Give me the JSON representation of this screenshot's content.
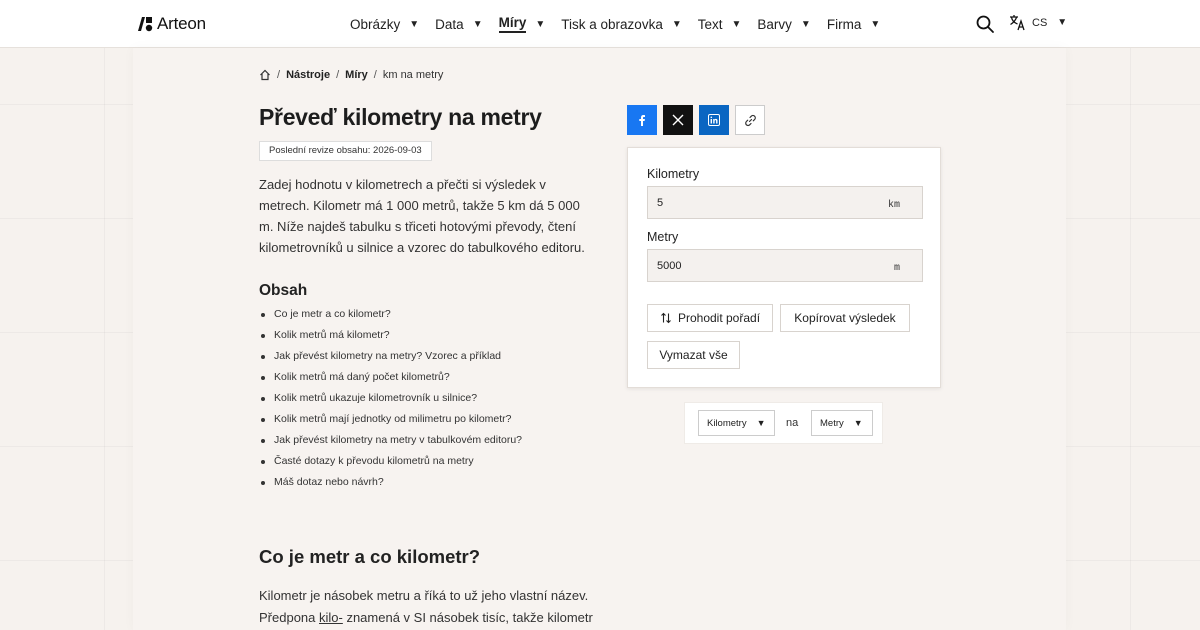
{
  "header": {
    "logo_text": "Arteon",
    "nav": [
      {
        "label": "Obrázky",
        "active": false
      },
      {
        "label": "Data",
        "active": false
      },
      {
        "label": "Míry",
        "active": true
      },
      {
        "label": "Tisk a obrazovka",
        "active": false
      },
      {
        "label": "Text",
        "active": false
      },
      {
        "label": "Barvy",
        "active": false
      },
      {
        "label": "Firma",
        "active": false
      }
    ],
    "lang": "CS",
    "icons": {
      "search": "search-icon",
      "lang": "translate-icon",
      "caret": "chevron-down-icon"
    }
  },
  "breadcrumb": {
    "home_icon": "home-icon",
    "items": [
      "Nástroje",
      "Míry",
      "km na metry"
    ]
  },
  "page": {
    "title": "Převeď kilometry na metry",
    "revision": "Poslední revize obsahu: 2026-09-03",
    "intro": "Zadej hodnotu v kilometrech a přečti si výsledek v metrech. Kilometr má 1 000 metrů, takže 5 km dá 5 000 m. Níže najdeš tabulku s třiceti hotovými převody, čtení kilometrovníků u silnice a vzorec do tabulkového editoru."
  },
  "toc": {
    "title": "Obsah",
    "items": [
      "Co je metr a co kilometr?",
      "Kolik metrů má kilometr?",
      "Jak převést kilometry na metry? Vzorec a příklad",
      "Kolik metrů má daný počet kilometrů?",
      "Kolik metrů ukazuje kilometrovník u silnice?",
      "Kolik metrů mají jednotky od milimetru po kilometr?",
      "Jak převést kilometry na metry v tabulkovém editoru?",
      "Časté dotazy k převodu kilometrů na metry",
      "Máš dotaz nebo návrh?"
    ]
  },
  "section": {
    "title": "Co je metr a co kilometr?",
    "text_before": "Kilometr je násobek metru a říká to už jeho vlastní název. Předpona ",
    "text_link": "kilo-",
    "text_after": " znamená v SI násobek tisíc, takže kilometr"
  },
  "share": {
    "icons": [
      "facebook-icon",
      "x-icon",
      "linkedin-icon",
      "link-icon"
    ]
  },
  "converter": {
    "from_label": "Kilometry",
    "from_value": "5",
    "from_unit": "km",
    "to_label": "Metry",
    "to_value": "5000",
    "to_unit": "m",
    "swap_label": "Prohodit pořadí",
    "copy_label": "Kopírovat výsledek",
    "clear_label": "Vymazat vše"
  },
  "unit_select": {
    "from": "Kilometry",
    "connector": "na",
    "to": "Metry"
  },
  "colors": {
    "facebook": "#1877f2",
    "x": "#111111",
    "linkedin": "#0a66c2",
    "background": "#f6f2ee"
  }
}
